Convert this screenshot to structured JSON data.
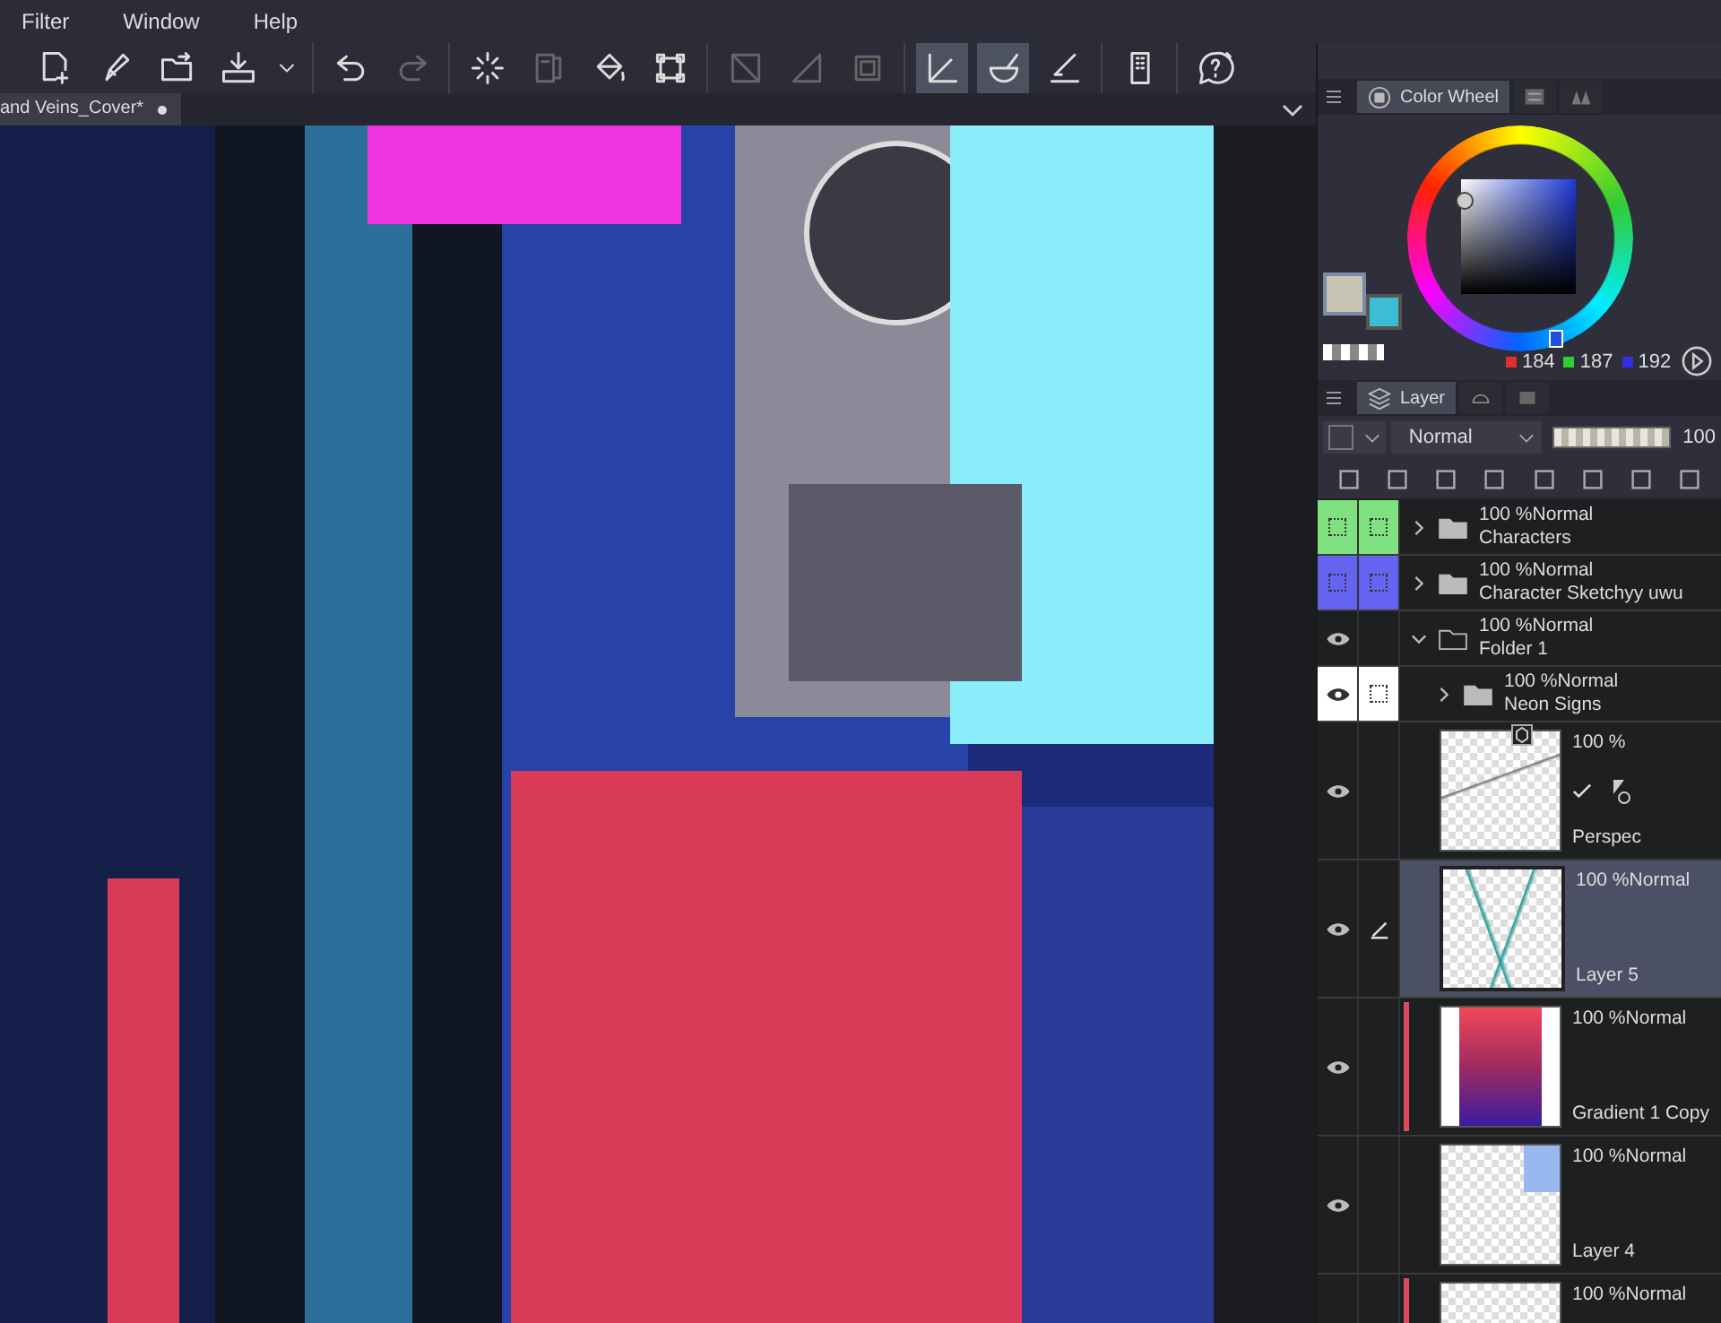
{
  "menu": [
    "Filter",
    "Window",
    "Help"
  ],
  "toolbar": [
    [
      {
        "kind": "new",
        "selected": false,
        "disabled": false
      },
      {
        "kind": "pen",
        "selected": false,
        "disabled": false
      },
      {
        "kind": "folder",
        "selected": false,
        "disabled": false
      },
      {
        "kind": "export",
        "selected": false,
        "disabled": false
      },
      {
        "kind": "caret",
        "selected": false,
        "disabled": false
      }
    ],
    [
      {
        "kind": "undo",
        "selected": false,
        "disabled": false
      },
      {
        "kind": "redo",
        "selected": false,
        "disabled": true
      }
    ],
    [
      {
        "kind": "spinner",
        "selected": false,
        "disabled": false
      },
      {
        "kind": "book",
        "selected": false,
        "disabled": true
      },
      {
        "kind": "bucket",
        "selected": false,
        "disabled": false
      },
      {
        "kind": "transform",
        "selected": false,
        "disabled": false
      }
    ],
    [
      {
        "kind": "deselect",
        "selected": false,
        "disabled": true
      },
      {
        "kind": "gradient",
        "selected": false,
        "disabled": true
      },
      {
        "kind": "crop",
        "selected": false,
        "disabled": true
      }
    ],
    [
      {
        "kind": "ruler",
        "selected": true,
        "disabled": false
      },
      {
        "kind": "bowl",
        "selected": true,
        "disabled": false
      },
      {
        "kind": "line",
        "selected": false,
        "disabled": false
      }
    ],
    [
      {
        "kind": "tablet",
        "selected": false,
        "disabled": false
      }
    ],
    [
      {
        "kind": "help",
        "selected": false,
        "disabled": false
      }
    ]
  ],
  "document_tab": {
    "title": "and Veins_Cover*"
  },
  "color_panel": {
    "tabs": [
      {
        "label": "Color Wheel",
        "selected": true
      },
      {
        "kind": "sliders",
        "selected": false
      },
      {
        "kind": "sets",
        "selected": false
      }
    ],
    "swatches": [
      {
        "color": "#c7c3b2",
        "selected": true
      },
      {
        "color": "#3dbdd4",
        "selected": false
      }
    ],
    "rgb": [
      "184",
      "187",
      "192"
    ]
  },
  "layer_panel": {
    "tab": "Layer",
    "blend_mode": "Normal",
    "opacity": {
      "level": 1,
      "value": "100"
    },
    "layers": [
      {
        "kind": "folder",
        "name": "Characters",
        "opacity": "100 %",
        "blend": "Normal",
        "visible": false,
        "selected": false,
        "expanded": false,
        "color": "#7ee07e"
      },
      {
        "kind": "folder",
        "name": "Character Sketchyy uwu",
        "opacity": "100 %",
        "blend": "Normal",
        "visible": false,
        "selected": false,
        "expanded": false,
        "color": "#6464f0"
      },
      {
        "kind": "folder",
        "name": "Folder 1",
        "opacity": "100 %",
        "blend": "Normal",
        "visible": true,
        "selected": false,
        "expanded": true,
        "children": [
          {
            "kind": "folder",
            "name": "Neon Signs",
            "opacity": "100 %",
            "blend": "Normal",
            "visible": true,
            "selected": false,
            "expanded": false,
            "marked": true
          },
          {
            "kind": "ruler",
            "thumbnail": {
              "kind": "sketch"
            },
            "name": "Perspec",
            "opacity": "100 %",
            "visible": true,
            "selected": false
          },
          {
            "kind": "raster",
            "thumbnail": {
              "kind": "strokes"
            },
            "name": "Layer 5",
            "opacity": "100 %",
            "blend": "Normal",
            "visible": true,
            "selected": true
          },
          {
            "kind": "raster",
            "thumbnail": {
              "kind": "gradient"
            },
            "name": "Gradient 1 Copy",
            "opacity": "100 %",
            "blend": "Normal",
            "visible": true,
            "selected": false,
            "clipped": true
          },
          {
            "kind": "raster",
            "thumbnail": {
              "kind": "shapes"
            },
            "name": "Layer 4",
            "opacity": "100 %",
            "blend": "Normal",
            "visible": true,
            "selected": false
          },
          {
            "kind": "raster",
            "thumbnail": {
              "kind": "faint"
            },
            "opacity": "100 %",
            "blend": "Normal",
            "visible": false,
            "selected": false,
            "clipped": true
          }
        ]
      }
    ]
  }
}
